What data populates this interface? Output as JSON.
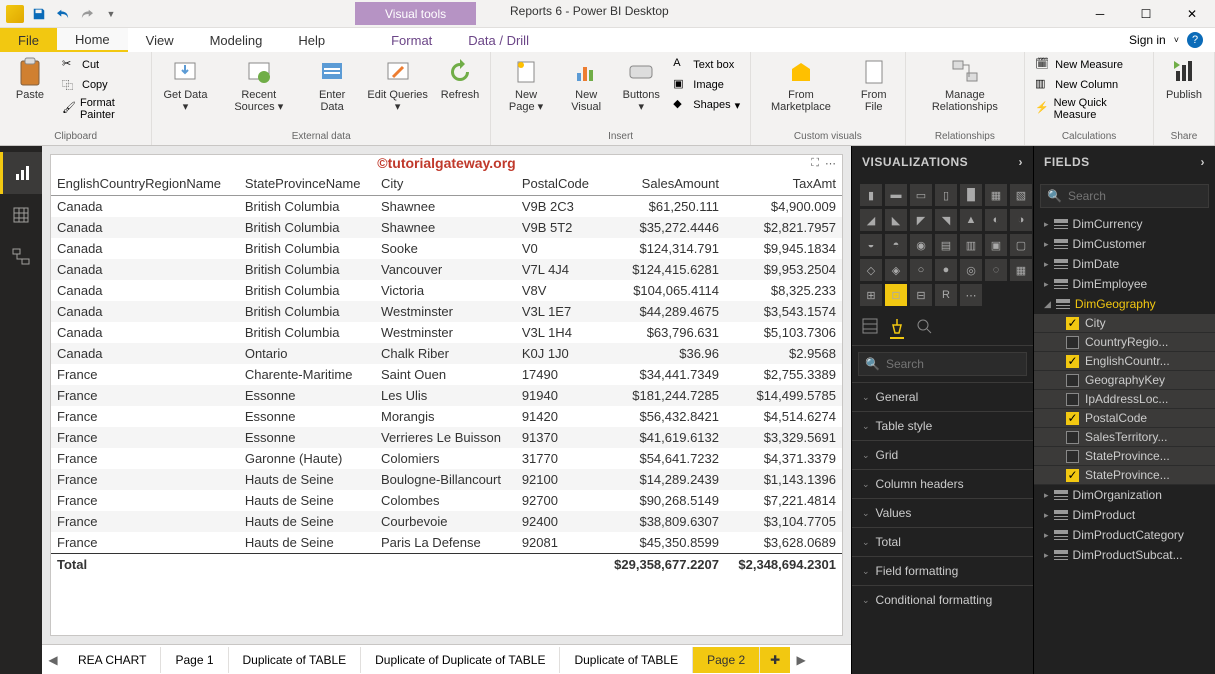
{
  "window": {
    "title": "Reports 6 - Power BI Desktop",
    "visual_tools": "Visual tools",
    "signin": "Sign in"
  },
  "menu": {
    "file": "File",
    "home": "Home",
    "view": "View",
    "modeling": "Modeling",
    "help": "Help",
    "format": "Format",
    "datadrill": "Data / Drill"
  },
  "ribbon": {
    "clipboard": {
      "label": "Clipboard",
      "paste": "Paste",
      "cut": "Cut",
      "copy": "Copy",
      "painter": "Format Painter"
    },
    "external": {
      "label": "External data",
      "get": "Get\nData",
      "recent": "Recent\nSources",
      "enter": "Enter\nData",
      "edit": "Edit\nQueries",
      "refresh": "Refresh"
    },
    "insert": {
      "label": "Insert",
      "newpage": "New\nPage",
      "newvisual": "New\nVisual",
      "buttons": "Buttons",
      "textbox": "Text box",
      "image": "Image",
      "shapes": "Shapes"
    },
    "custom": {
      "label": "Custom visuals",
      "marketplace": "From\nMarketplace",
      "file": "From\nFile"
    },
    "rel": {
      "label": "Relationships",
      "manage": "Manage\nRelationships"
    },
    "calc": {
      "label": "Calculations",
      "measure": "New Measure",
      "column": "New Column",
      "quick": "New Quick Measure"
    },
    "share": {
      "label": "Share",
      "publish": "Publish"
    }
  },
  "watermark": "©tutorialgateway.org",
  "table": {
    "headers": [
      "EnglishCountryRegionName",
      "StateProvinceName",
      "City",
      "PostalCode",
      "SalesAmount",
      "TaxAmt"
    ],
    "rows": [
      [
        "Canada",
        "British Columbia",
        "Shawnee",
        "V9B 2C3",
        "$61,250.111",
        "$4,900.009"
      ],
      [
        "Canada",
        "British Columbia",
        "Shawnee",
        "V9B 5T2",
        "$35,272.4446",
        "$2,821.7957"
      ],
      [
        "Canada",
        "British Columbia",
        "Sooke",
        "V0",
        "$124,314.791",
        "$9,945.1834"
      ],
      [
        "Canada",
        "British Columbia",
        "Vancouver",
        "V7L 4J4",
        "$124,415.6281",
        "$9,953.2504"
      ],
      [
        "Canada",
        "British Columbia",
        "Victoria",
        "V8V",
        "$104,065.4114",
        "$8,325.233"
      ],
      [
        "Canada",
        "British Columbia",
        "Westminster",
        "V3L 1E7",
        "$44,289.4675",
        "$3,543.1574"
      ],
      [
        "Canada",
        "British Columbia",
        "Westminster",
        "V3L 1H4",
        "$63,796.631",
        "$5,103.7306"
      ],
      [
        "Canada",
        "Ontario",
        "Chalk Riber",
        "K0J 1J0",
        "$36.96",
        "$2.9568"
      ],
      [
        "France",
        "Charente-Maritime",
        "Saint Ouen",
        "17490",
        "$34,441.7349",
        "$2,755.3389"
      ],
      [
        "France",
        "Essonne",
        "Les Ulis",
        "91940",
        "$181,244.7285",
        "$14,499.5785"
      ],
      [
        "France",
        "Essonne",
        "Morangis",
        "91420",
        "$56,432.8421",
        "$4,514.6274"
      ],
      [
        "France",
        "Essonne",
        "Verrieres Le Buisson",
        "91370",
        "$41,619.6132",
        "$3,329.5691"
      ],
      [
        "France",
        "Garonne (Haute)",
        "Colomiers",
        "31770",
        "$54,641.7232",
        "$4,371.3379"
      ],
      [
        "France",
        "Hauts de Seine",
        "Boulogne-Billancourt",
        "92100",
        "$14,289.2439",
        "$1,143.1396"
      ],
      [
        "France",
        "Hauts de Seine",
        "Colombes",
        "92700",
        "$90,268.5149",
        "$7,221.4814"
      ],
      [
        "France",
        "Hauts de Seine",
        "Courbevoie",
        "92400",
        "$38,809.6307",
        "$3,104.7705"
      ],
      [
        "France",
        "Hauts de Seine",
        "Paris La Defense",
        "92081",
        "$45,350.8599",
        "$3,628.0689"
      ]
    ],
    "total_label": "Total",
    "total_sales": "$29,358,677.2207",
    "total_tax": "$2,348,694.2301"
  },
  "pages": [
    "REA CHART",
    "Page 1",
    "Duplicate of TABLE",
    "Duplicate of Duplicate of TABLE",
    "Duplicate of TABLE",
    "Page 2"
  ],
  "viz": {
    "title": "VISUALIZATIONS",
    "search": "Search",
    "sections": [
      "General",
      "Table style",
      "Grid",
      "Column headers",
      "Values",
      "Total",
      "Field formatting",
      "Conditional formatting"
    ]
  },
  "fields": {
    "title": "FIELDS",
    "search": "Search",
    "tables": [
      "DimCurrency",
      "DimCustomer",
      "DimDate",
      "DimEmployee"
    ],
    "expanded": "DimGeography",
    "cols": [
      {
        "name": "City",
        "on": true
      },
      {
        "name": "CountryRegio...",
        "on": false
      },
      {
        "name": "EnglishCountr...",
        "on": true
      },
      {
        "name": "GeographyKey",
        "on": false
      },
      {
        "name": "IpAddressLoc...",
        "on": false
      },
      {
        "name": "PostalCode",
        "on": true
      },
      {
        "name": "SalesTerritory...",
        "on": false
      },
      {
        "name": "StateProvince...",
        "on": false
      },
      {
        "name": "StateProvince...",
        "on": true
      }
    ],
    "tables2": [
      "DimOrganization",
      "DimProduct",
      "DimProductCategory",
      "DimProductSubcat..."
    ]
  }
}
